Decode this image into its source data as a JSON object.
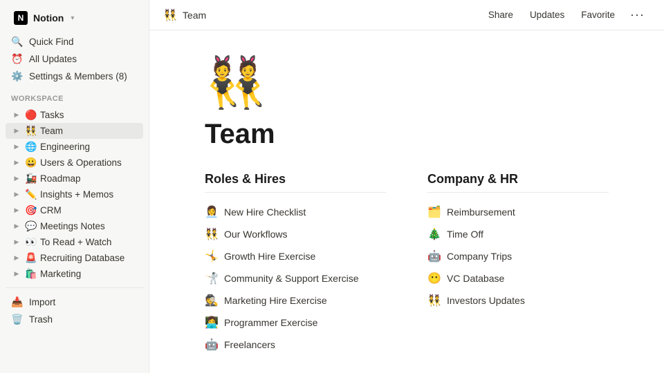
{
  "app": {
    "name": "Notion",
    "workspace": "Notion",
    "workspace_chevron": "▾"
  },
  "sidebar": {
    "nav_items": [
      {
        "id": "quick-find",
        "icon": "🔍",
        "label": "Quick Find"
      },
      {
        "id": "all-updates",
        "icon": "⏰",
        "label": "All Updates"
      },
      {
        "id": "settings",
        "icon": "⚙️",
        "label": "Settings & Members (8)"
      }
    ],
    "workspace_label": "WORKSPACE",
    "tree_items": [
      {
        "id": "tasks",
        "emoji": "🔴",
        "label": "Tasks",
        "active": false
      },
      {
        "id": "team",
        "emoji": "👯",
        "label": "Team",
        "active": true
      },
      {
        "id": "engineering",
        "emoji": "🌐",
        "label": "Engineering",
        "active": false
      },
      {
        "id": "users-ops",
        "emoji": "😀",
        "label": "Users & Operations",
        "active": false
      },
      {
        "id": "roadmap",
        "emoji": "🚂",
        "label": "Roadmap",
        "active": false
      },
      {
        "id": "insights",
        "emoji": "✏️",
        "label": "Insights + Memos",
        "active": false
      },
      {
        "id": "crm",
        "emoji": "🎯",
        "label": "CRM",
        "active": false
      },
      {
        "id": "meetings",
        "emoji": "💬",
        "label": "Meetings Notes",
        "active": false
      },
      {
        "id": "to-read",
        "emoji": "👀",
        "label": "To Read + Watch",
        "active": false
      },
      {
        "id": "recruiting",
        "emoji": "🚨",
        "label": "Recruiting Database",
        "active": false
      },
      {
        "id": "marketing",
        "emoji": "🛍️",
        "label": "Marketing",
        "active": false
      }
    ],
    "bottom_items": [
      {
        "id": "import",
        "icon": "📥",
        "label": "Import"
      },
      {
        "id": "trash",
        "icon": "🗑️",
        "label": "Trash"
      }
    ]
  },
  "topbar": {
    "page_emoji": "👯",
    "page_title": "Team",
    "share_label": "Share",
    "updates_label": "Updates",
    "favorite_label": "Favorite",
    "more_label": "···"
  },
  "page": {
    "hero_emoji": "👯",
    "title": "Team",
    "sections": [
      {
        "id": "roles-hires",
        "title": "Roles & Hires",
        "items": [
          {
            "emoji": "👩‍💼",
            "label": "New Hire Checklist"
          },
          {
            "emoji": "👯",
            "label": "Our Workflows"
          },
          {
            "emoji": "🤸",
            "label": "Growth Hire Exercise"
          },
          {
            "emoji": "🤺",
            "label": "Community & Support Exercise"
          },
          {
            "emoji": "🕵️",
            "label": "Marketing Hire Exercise"
          },
          {
            "emoji": "👩‍💻",
            "label": "Programmer Exercise"
          },
          {
            "emoji": "🤖",
            "label": "Freelancers"
          }
        ]
      },
      {
        "id": "company-hr",
        "title": "Company & HR",
        "items": [
          {
            "emoji": "🗂️",
            "label": "Reimbursement"
          },
          {
            "emoji": "🎄",
            "label": "Time Off"
          },
          {
            "emoji": "🤖",
            "label": "Company Trips"
          },
          {
            "emoji": "😶",
            "label": "VC Database"
          },
          {
            "emoji": "👯",
            "label": "Investors Updates"
          }
        ]
      }
    ]
  }
}
